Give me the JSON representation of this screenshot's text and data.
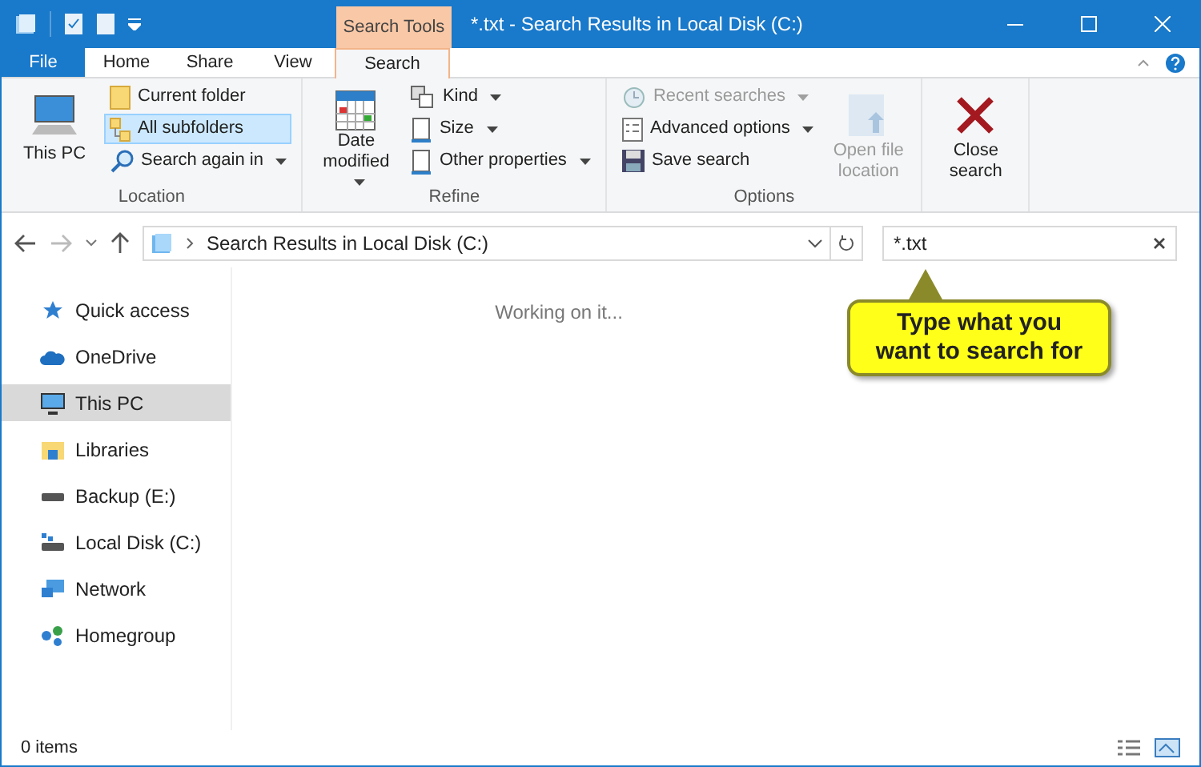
{
  "title_bar": {
    "context_tab": "Search Tools",
    "title": "*.txt - Search Results in Local Disk (C:)"
  },
  "ribbon_tabs": [
    {
      "label": "File",
      "kind": "file",
      "selected": false
    },
    {
      "label": "Home",
      "kind": "tab",
      "selected": false
    },
    {
      "label": "Share",
      "kind": "tab",
      "selected": false
    },
    {
      "label": "View",
      "kind": "tab",
      "selected": false
    },
    {
      "label": "Search",
      "kind": "context",
      "selected": true
    }
  ],
  "ribbon_groups": [
    {
      "label": "Location",
      "items": [
        {
          "kind": "large",
          "label": "This PC",
          "disabled": false,
          "dropdown": false,
          "selected": false
        },
        {
          "kind": "small",
          "label": "Current folder",
          "disabled": false,
          "dropdown": false,
          "selected": false
        },
        {
          "kind": "small",
          "label": "All subfolders",
          "disabled": false,
          "dropdown": false,
          "selected": true
        },
        {
          "kind": "small",
          "label": "Search again in",
          "disabled": false,
          "dropdown": true,
          "selected": false
        }
      ]
    },
    {
      "label": "Refine",
      "items": [
        {
          "kind": "large",
          "label": "Date modified",
          "disabled": false,
          "dropdown": true,
          "selected": false
        },
        {
          "kind": "small",
          "label": "Kind",
          "disabled": false,
          "dropdown": true,
          "selected": false
        },
        {
          "kind": "small",
          "label": "Size",
          "disabled": false,
          "dropdown": true,
          "selected": false
        },
        {
          "kind": "small",
          "label": "Other properties",
          "disabled": false,
          "dropdown": true,
          "selected": false
        }
      ]
    },
    {
      "label": "Options",
      "items": [
        {
          "kind": "small",
          "label": "Recent searches",
          "disabled": true,
          "dropdown": true,
          "selected": false
        },
        {
          "kind": "small",
          "label": "Advanced options",
          "disabled": false,
          "dropdown": true,
          "selected": false
        },
        {
          "kind": "small",
          "label": "Save search",
          "disabled": false,
          "dropdown": false,
          "selected": false
        },
        {
          "kind": "large",
          "label": "Open file location",
          "disabled": true,
          "dropdown": false,
          "selected": false
        }
      ]
    },
    {
      "items": [
        {
          "kind": "large",
          "label": "Close search",
          "disabled": false,
          "dropdown": false,
          "selected": false
        }
      ]
    }
  ],
  "address_bar": {
    "path": "Search Results in Local Disk (C:)"
  },
  "search_box": {
    "value": "*.txt"
  },
  "navigation_pane": {
    "items": [
      {
        "label": "Quick access",
        "selected": false
      },
      {
        "label": "OneDrive",
        "selected": false
      },
      {
        "label": "This PC",
        "selected": true
      },
      {
        "label": "Libraries",
        "selected": false
      },
      {
        "label": "Backup (E:)",
        "selected": false
      },
      {
        "label": "Local Disk (C:)",
        "selected": false
      },
      {
        "label": "Network",
        "selected": false
      },
      {
        "label": "Homegroup",
        "selected": false
      }
    ]
  },
  "content": {
    "status": "Working on it..."
  },
  "callout": {
    "text": "Type what you want to search for"
  },
  "status_bar": {
    "item_count": "0 items"
  }
}
